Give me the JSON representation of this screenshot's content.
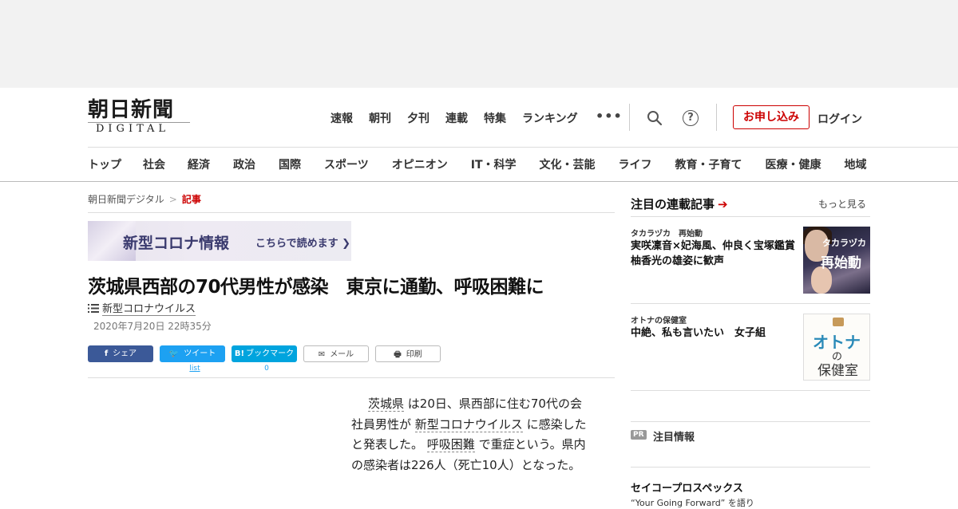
{
  "logo": {
    "jp": "朝日新聞",
    "en": "DIGITAL"
  },
  "topnav": [
    "速報",
    "朝刊",
    "夕刊",
    "連載",
    "特集",
    "ランキング"
  ],
  "topnav_more": "•••",
  "help_symbol": "?",
  "apply_label": "お申し込み",
  "login_label": "ログイン",
  "catnav": [
    "トップ",
    "社会",
    "経済",
    "政治",
    "国際",
    "スポーツ",
    "オピニオン",
    "IT・科学",
    "文化・芸能",
    "ライフ",
    "教育・子育て",
    "医療・健康",
    "地域"
  ],
  "breadcrumb": {
    "home": "朝日新聞デジタル",
    "sep": ">",
    "current": "記事"
  },
  "corona_banner": {
    "main": "新型コロナ情報",
    "sub": "こちらで読めます"
  },
  "article": {
    "headline": "茨城県西部の70代男性が感染　東京に通勤、呼吸困難に",
    "tag": "新型コロナウイルス",
    "date": "2020年7月20日 22時35分",
    "body": {
      "kw1": "茨城県",
      "t1": " は20日、県西部に住む70代の会社員男性が ",
      "kw2": "新型コロナウイルス",
      "t2": " に感染したと発表した。 ",
      "kw3": "呼吸困難",
      "t3": " で重症という。県内の感染者は226人（死亡10人）となった。"
    }
  },
  "share": {
    "facebook": "シェア",
    "twitter": "ツイート",
    "twitter_count": "list",
    "hatena": "ブックマーク",
    "hatena_icon": "B!",
    "hatena_count": "0",
    "mail": "メール",
    "print": "印刷"
  },
  "sidebar": {
    "heading": "注目の連載記事",
    "more": "もっと見る",
    "items": [
      {
        "category": "タカラヅカ　再始動",
        "title": "実咲凜音×妃海風、仲良く宝塚鑑賞　柚香光の雄姿に歓声",
        "thumb_top": "タカラヅカ",
        "thumb_main": "再始動"
      },
      {
        "category": "オトナの保健室",
        "title": "中絶、私も言いたい　女子組",
        "thumb_l1": "オトナ",
        "thumb_l2": "の",
        "thumb_l3": "保健室"
      }
    ],
    "pr_badge": "PR",
    "pr_label": "注目情報",
    "sponsor": "セイコープロスペックス",
    "sponsor_sub": "“Your Going Forward” を語り"
  },
  "colors": {
    "accent": "#cc0000",
    "facebook": "#3b5998",
    "twitter": "#1da1f2",
    "hatena": "#00a4de"
  }
}
